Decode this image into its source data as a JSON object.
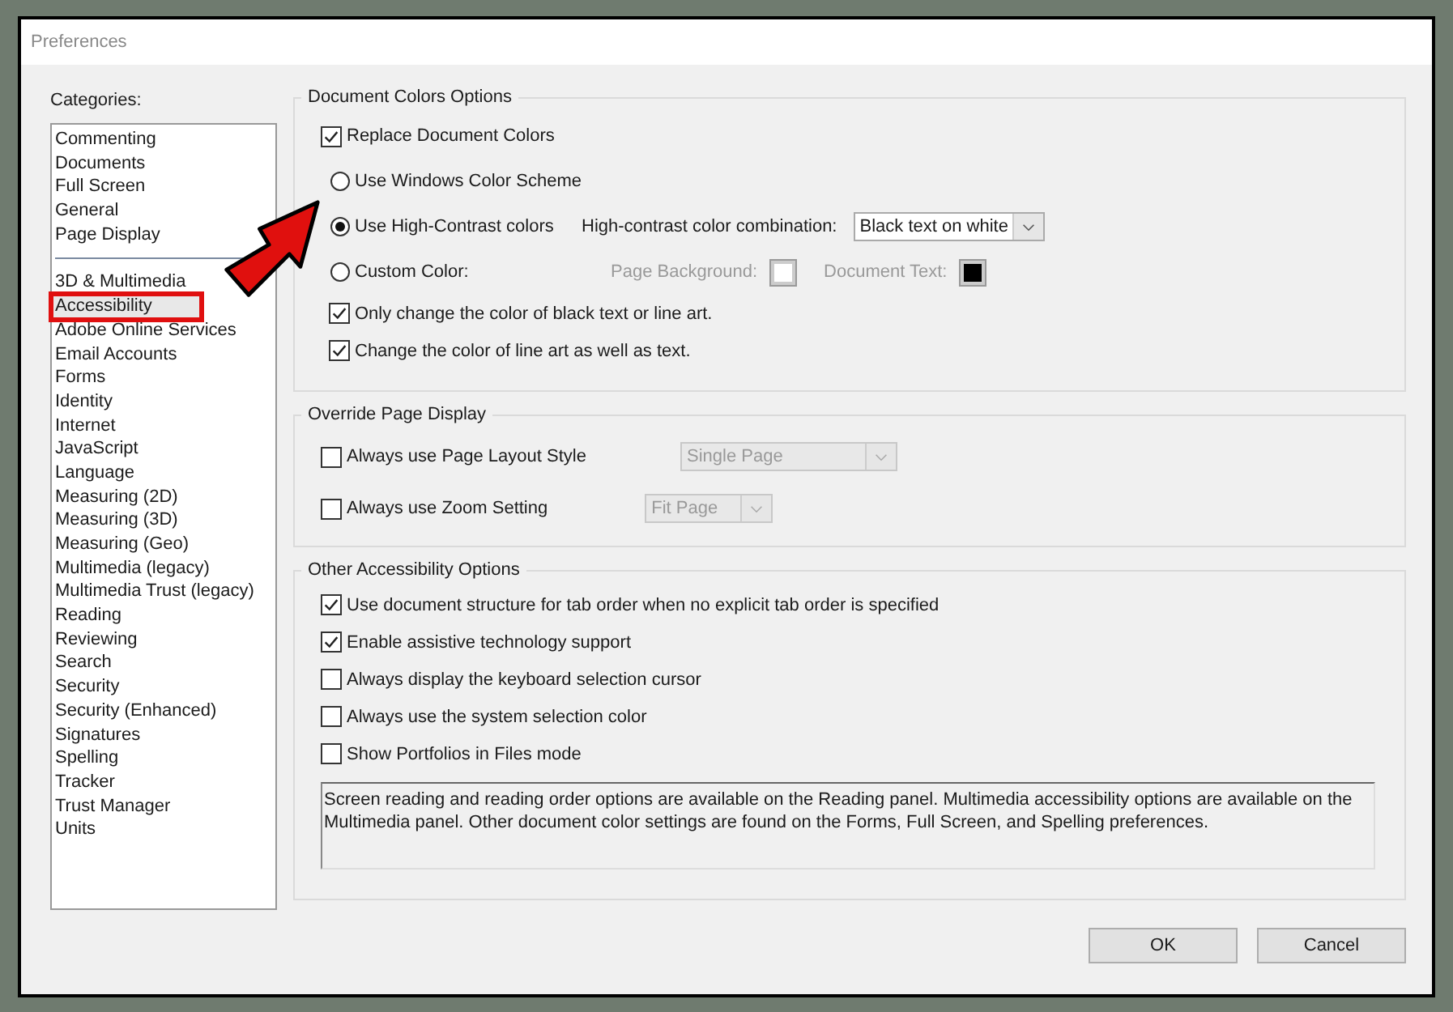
{
  "window": {
    "title": "Preferences"
  },
  "categories": {
    "label": "Categories:",
    "items": [
      {
        "label": "Commenting",
        "selected": false,
        "highlighted": false,
        "separator_after": false
      },
      {
        "label": "Documents",
        "selected": false,
        "highlighted": false,
        "separator_after": false
      },
      {
        "label": "Full Screen",
        "selected": false,
        "highlighted": false,
        "separator_after": false
      },
      {
        "label": "General",
        "selected": false,
        "highlighted": false,
        "separator_after": false
      },
      {
        "label": "Page Display",
        "selected": false,
        "highlighted": false,
        "separator_after": true
      },
      {
        "label": "3D & Multimedia",
        "selected": false,
        "highlighted": false,
        "separator_after": false
      },
      {
        "label": "Accessibility",
        "selected": true,
        "highlighted": true,
        "separator_after": false
      },
      {
        "label": "Adobe Online Services",
        "selected": false,
        "highlighted": false,
        "separator_after": false
      },
      {
        "label": "Email Accounts",
        "selected": false,
        "highlighted": false,
        "separator_after": false
      },
      {
        "label": "Forms",
        "selected": false,
        "highlighted": false,
        "separator_after": false
      },
      {
        "label": "Identity",
        "selected": false,
        "highlighted": false,
        "separator_after": false
      },
      {
        "label": "Internet",
        "selected": false,
        "highlighted": false,
        "separator_after": false
      },
      {
        "label": "JavaScript",
        "selected": false,
        "highlighted": false,
        "separator_after": false
      },
      {
        "label": "Language",
        "selected": false,
        "highlighted": false,
        "separator_after": false
      },
      {
        "label": "Measuring (2D)",
        "selected": false,
        "highlighted": false,
        "separator_after": false
      },
      {
        "label": "Measuring (3D)",
        "selected": false,
        "highlighted": false,
        "separator_after": false
      },
      {
        "label": "Measuring (Geo)",
        "selected": false,
        "highlighted": false,
        "separator_after": false
      },
      {
        "label": "Multimedia (legacy)",
        "selected": false,
        "highlighted": false,
        "separator_after": false
      },
      {
        "label": "Multimedia Trust (legacy)",
        "selected": false,
        "highlighted": false,
        "separator_after": false
      },
      {
        "label": "Reading",
        "selected": false,
        "highlighted": false,
        "separator_after": false
      },
      {
        "label": "Reviewing",
        "selected": false,
        "highlighted": false,
        "separator_after": false
      },
      {
        "label": "Search",
        "selected": false,
        "highlighted": false,
        "separator_after": false
      },
      {
        "label": "Security",
        "selected": false,
        "highlighted": false,
        "separator_after": false
      },
      {
        "label": "Security (Enhanced)",
        "selected": false,
        "highlighted": false,
        "separator_after": false
      },
      {
        "label": "Signatures",
        "selected": false,
        "highlighted": false,
        "separator_after": false
      },
      {
        "label": "Spelling",
        "selected": false,
        "highlighted": false,
        "separator_after": false
      },
      {
        "label": "Tracker",
        "selected": false,
        "highlighted": false,
        "separator_after": false
      },
      {
        "label": "Trust Manager",
        "selected": false,
        "highlighted": false,
        "separator_after": false
      },
      {
        "label": "Units",
        "selected": false,
        "highlighted": false,
        "separator_after": false
      }
    ]
  },
  "groups": [
    {
      "title": "Document Colors Options",
      "options": [
        {
          "kind": "checkbox",
          "label": "Replace Document Colors",
          "checked": true
        },
        {
          "kind": "radio",
          "label": "Use Windows Color Scheme",
          "selected": false
        },
        {
          "kind": "radio",
          "label": "Use High-Contrast colors",
          "selected": true,
          "combo": {
            "label": "High-contrast color combination:",
            "value": "Black text on white",
            "disabled": false
          }
        },
        {
          "kind": "radio",
          "label": "Custom Color:",
          "selected": false,
          "swatches": [
            {
              "label": "Page Background:",
              "color": "#ffffff",
              "disabled": true
            },
            {
              "label": "Document Text:",
              "color": "#000000",
              "disabled": true
            }
          ]
        },
        {
          "kind": "subcheckbox",
          "label": "Only change the color of black text or line art.",
          "checked": true
        },
        {
          "kind": "subcheckbox",
          "label": "Change the color of line art as well as text.",
          "checked": true
        }
      ]
    },
    {
      "title": "Override Page Display",
      "options": [
        {
          "kind": "checkbox",
          "label": "Always use Page Layout Style",
          "checked": false,
          "select": {
            "value": "Single Page",
            "disabled": true
          }
        },
        {
          "kind": "checkbox",
          "label": "Always use Zoom Setting",
          "checked": false,
          "select": {
            "value": "Fit Page",
            "disabled": true
          }
        }
      ]
    },
    {
      "title": "Other Accessibility Options",
      "options": [
        {
          "kind": "checkbox",
          "label": "Use document structure for tab order when no explicit tab order is specified",
          "checked": true
        },
        {
          "kind": "checkbox",
          "label": "Enable assistive technology support",
          "checked": true
        },
        {
          "kind": "checkbox",
          "label": "Always display the keyboard selection cursor",
          "checked": false
        },
        {
          "kind": "checkbox",
          "label": "Always use the system selection color",
          "checked": false
        },
        {
          "kind": "checkbox",
          "label": "Show Portfolios in Files mode",
          "checked": false
        },
        {
          "kind": "note",
          "text": "Screen reading and reading order options are available on the Reading panel. Multimedia accessibility options are available on the Multimedia panel. Other document color settings are found on the Forms, Full Screen, and Spelling preferences."
        }
      ]
    }
  ],
  "buttons": [
    "OK",
    "Cancel"
  ]
}
